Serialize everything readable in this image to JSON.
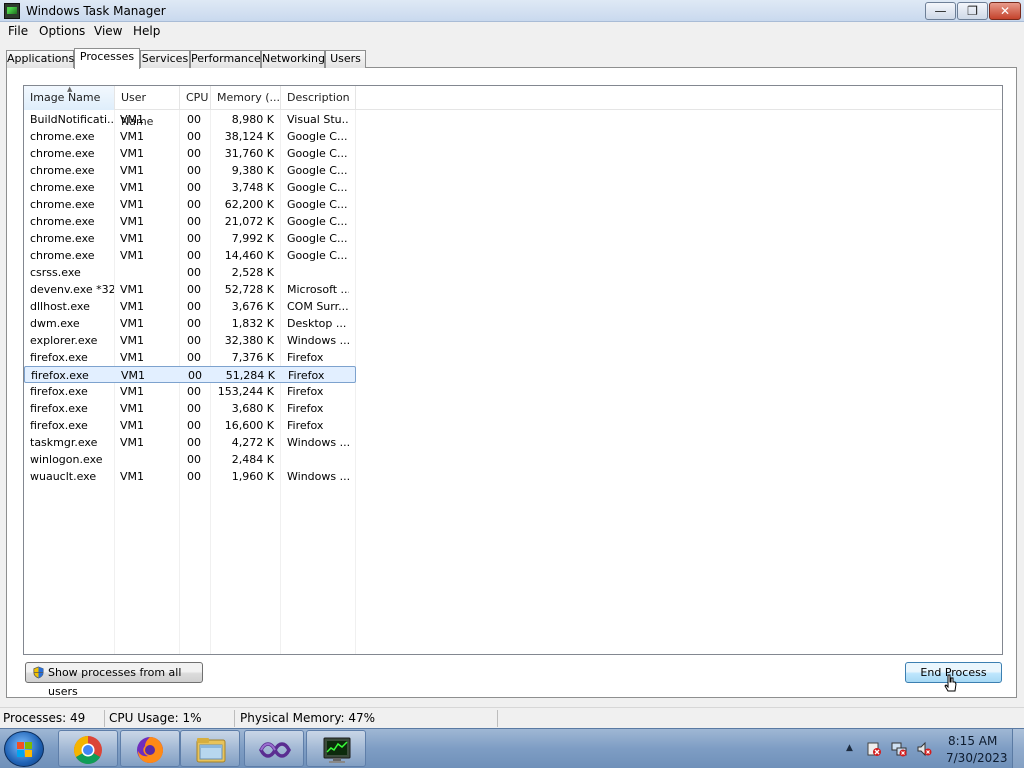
{
  "window": {
    "title": "Windows Task Manager",
    "min_glyph": "—",
    "max_glyph": "❐",
    "close_glyph": "✕"
  },
  "menu": [
    "File",
    "Options",
    "View",
    "Help"
  ],
  "tabs": [
    {
      "label": "Applications",
      "active": false
    },
    {
      "label": "Processes",
      "active": true
    },
    {
      "label": "Services",
      "active": false
    },
    {
      "label": "Performance",
      "active": false
    },
    {
      "label": "Networking",
      "active": false
    },
    {
      "label": "Users",
      "active": false
    }
  ],
  "columns": {
    "image_name": "Image Name",
    "user_name": "User Name",
    "cpu": "CPU",
    "memory": "Memory (...",
    "description": "Description"
  },
  "processes": [
    {
      "name": "BuildNotificati...",
      "user": "VM1",
      "cpu": "00",
      "memory": "8,980 K",
      "description": "Visual Stu..."
    },
    {
      "name": "chrome.exe",
      "user": "VM1",
      "cpu": "00",
      "memory": "38,124 K",
      "description": "Google C..."
    },
    {
      "name": "chrome.exe",
      "user": "VM1",
      "cpu": "00",
      "memory": "31,760 K",
      "description": "Google C..."
    },
    {
      "name": "chrome.exe",
      "user": "VM1",
      "cpu": "00",
      "memory": "9,380 K",
      "description": "Google C..."
    },
    {
      "name": "chrome.exe",
      "user": "VM1",
      "cpu": "00",
      "memory": "3,748 K",
      "description": "Google C..."
    },
    {
      "name": "chrome.exe",
      "user": "VM1",
      "cpu": "00",
      "memory": "62,200 K",
      "description": "Google C..."
    },
    {
      "name": "chrome.exe",
      "user": "VM1",
      "cpu": "00",
      "memory": "21,072 K",
      "description": "Google C..."
    },
    {
      "name": "chrome.exe",
      "user": "VM1",
      "cpu": "00",
      "memory": "7,992 K",
      "description": "Google C..."
    },
    {
      "name": "chrome.exe",
      "user": "VM1",
      "cpu": "00",
      "memory": "14,460 K",
      "description": "Google C..."
    },
    {
      "name": "csrss.exe",
      "user": "",
      "cpu": "00",
      "memory": "2,528 K",
      "description": ""
    },
    {
      "name": "devenv.exe *32",
      "user": "VM1",
      "cpu": "00",
      "memory": "52,728 K",
      "description": "Microsoft ..."
    },
    {
      "name": "dllhost.exe",
      "user": "VM1",
      "cpu": "00",
      "memory": "3,676 K",
      "description": "COM Surr..."
    },
    {
      "name": "dwm.exe",
      "user": "VM1",
      "cpu": "00",
      "memory": "1,832 K",
      "description": "Desktop ..."
    },
    {
      "name": "explorer.exe",
      "user": "VM1",
      "cpu": "00",
      "memory": "32,380 K",
      "description": "Windows ..."
    },
    {
      "name": "firefox.exe",
      "user": "VM1",
      "cpu": "00",
      "memory": "7,376 K",
      "description": "Firefox"
    },
    {
      "name": "firefox.exe",
      "user": "VM1",
      "cpu": "00",
      "memory": "51,284 K",
      "description": "Firefox",
      "selected": true
    },
    {
      "name": "firefox.exe",
      "user": "VM1",
      "cpu": "00",
      "memory": "153,244 K",
      "description": "Firefox"
    },
    {
      "name": "firefox.exe",
      "user": "VM1",
      "cpu": "00",
      "memory": "3,680 K",
      "description": "Firefox"
    },
    {
      "name": "firefox.exe",
      "user": "VM1",
      "cpu": "00",
      "memory": "16,600 K",
      "description": "Firefox"
    },
    {
      "name": "taskmgr.exe",
      "user": "VM1",
      "cpu": "00",
      "memory": "4,272 K",
      "description": "Windows ..."
    },
    {
      "name": "winlogon.exe",
      "user": "",
      "cpu": "00",
      "memory": "2,484 K",
      "description": ""
    },
    {
      "name": "wuauclt.exe",
      "user": "VM1",
      "cpu": "00",
      "memory": "1,960 K",
      "description": "Windows ..."
    }
  ],
  "buttons": {
    "show_all_users": "Show processes from all users",
    "end_process": "End Process"
  },
  "status": {
    "processes": "Processes: 49",
    "cpu_usage": "CPU Usage: 1%",
    "physical_memory": "Physical Memory: 47%"
  },
  "taskbar": {
    "apps": [
      "chrome-icon",
      "firefox-icon",
      "file-explorer-icon",
      "visual-studio-icon",
      "task-manager-icon"
    ],
    "clock_time": "8:15 AM",
    "clock_date": "7/30/2023",
    "tray_arrow": "▲"
  },
  "colors": {
    "selection_bg": "#e2efff",
    "selection_border": "#7da2ce",
    "taskbar": "#7e9dc4"
  }
}
